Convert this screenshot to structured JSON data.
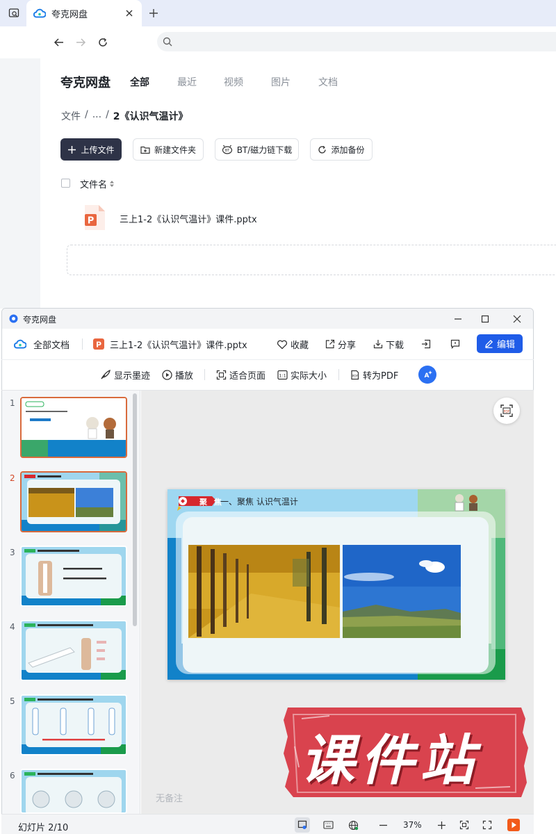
{
  "browser": {
    "tab_title": "夸克网盘",
    "colors": {
      "tabbar": "#e7ecf9",
      "accent": "#1f5ce8"
    }
  },
  "drive": {
    "logo_text": "夸克网盘",
    "tabs": [
      {
        "label": "全部",
        "active": true
      },
      {
        "label": "最近",
        "active": false
      },
      {
        "label": "视频",
        "active": false
      },
      {
        "label": "图片",
        "active": false
      },
      {
        "label": "文档",
        "active": false
      }
    ],
    "breadcrumb": [
      "文件",
      "/",
      "...",
      "/",
      "2《认识气温计》"
    ],
    "toolbar": {
      "upload": "上传文件",
      "new_folder": "新建文件夹",
      "bt_download": "BT/磁力链下载",
      "add_backup": "添加备份"
    },
    "list_header": {
      "name": "文件名"
    },
    "files": [
      {
        "name": "三上1-2《认识气温计》课件.pptx",
        "icon": "pptx-file-icon"
      }
    ]
  },
  "viewer": {
    "window_title": "夸克网盘",
    "toolbar1": {
      "all_docs": "全部文档",
      "file_name": "三上1-2《认识气温计》课件.pptx",
      "favorite": "收藏",
      "share": "分享",
      "download": "下载",
      "edit": "编辑"
    },
    "toolbar2": {
      "show_ink": "显示墨迹",
      "play": "播放",
      "fit_page": "适合页面",
      "actual_size": "实际大小",
      "to_pdf": "转为PDF"
    },
    "thumbnails": [
      {
        "num": "1",
        "selected": false
      },
      {
        "num": "2",
        "selected": true
      },
      {
        "num": "3",
        "selected": false
      },
      {
        "num": "4",
        "selected": false
      },
      {
        "num": "5",
        "selected": false
      },
      {
        "num": "6",
        "selected": false
      }
    ],
    "slide": {
      "badge": "聚 焦",
      "title": "一、聚焦  认识气温计"
    },
    "notes": "无备注",
    "status": {
      "slide_counter": "幻灯片 2/10",
      "zoom": "37%"
    }
  },
  "watermark": {
    "text": "课件站",
    "color": "#d9434e"
  }
}
